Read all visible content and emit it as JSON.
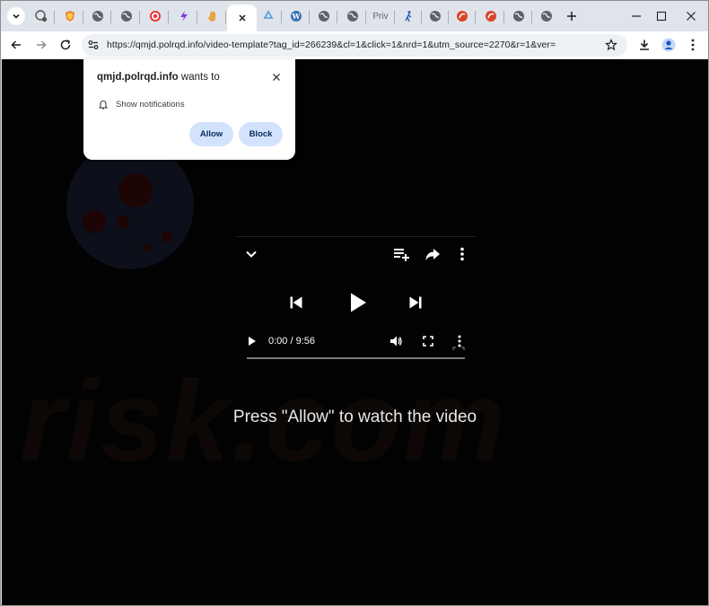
{
  "browser": {
    "tabs": [
      {
        "icon": "globe-gear-icon"
      },
      {
        "icon": "brave-shield-icon"
      },
      {
        "icon": "globe-icon"
      },
      {
        "icon": "globe-icon"
      },
      {
        "icon": "target-icon"
      },
      {
        "icon": "bolt-icon"
      },
      {
        "icon": "hand-icon"
      },
      {
        "icon": "close-icon",
        "active": true
      },
      {
        "icon": "recycle-icon"
      },
      {
        "icon": "wordpress-icon"
      },
      {
        "icon": "globe-icon"
      },
      {
        "icon": "globe-icon",
        "label": "Priv"
      },
      {
        "icon": "walking-person-icon"
      },
      {
        "icon": "globe-icon"
      },
      {
        "icon": "red-swirl-icon"
      },
      {
        "icon": "red-swirl-icon"
      },
      {
        "icon": "globe-icon"
      },
      {
        "icon": "globe-icon"
      }
    ],
    "url": "https://qmjd.polrqd.info/video-template?tag_id=266239&cl=1&click=1&nrd=1&utm_source=2270&r=1&ver=",
    "colors": {
      "frame": "#dfe3ea",
      "toolbar": "#ffffff",
      "omnibox": "#edf0f5"
    }
  },
  "popup": {
    "site": "qmjd.polrqd.info",
    "wants_to": "wants to",
    "permission": "Show notifications",
    "allow_label": "Allow",
    "block_label": "Block",
    "button_color": "#d3e3fd"
  },
  "player": {
    "time": "0:00 / 9:56",
    "progress": 0
  },
  "page": {
    "cta": "Press \"Allow\" to watch the video",
    "watermark": "risk.com",
    "background": "#020202"
  }
}
